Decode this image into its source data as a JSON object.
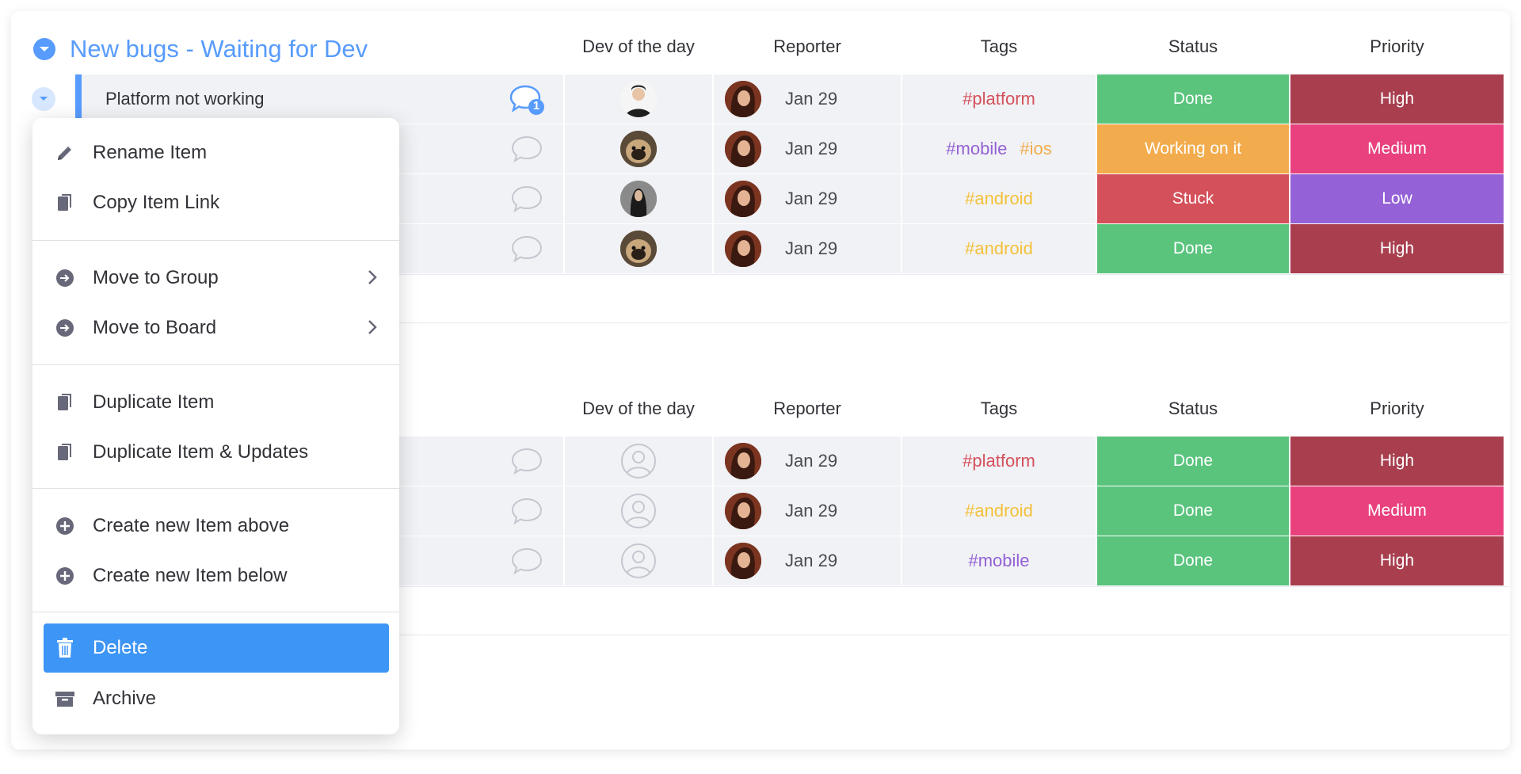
{
  "groups": [
    {
      "title": "New bugs - Waiting for Dev",
      "columns": {
        "dev": "Dev of the day",
        "reporter": "Reporter",
        "tags": "Tags",
        "status": "Status",
        "priority": "Priority"
      },
      "rows": [
        {
          "name": "Platform not working",
          "updates": "1",
          "date": "Jan 29",
          "tags": [
            "#platform"
          ],
          "status": "Done",
          "priority": "High"
        },
        {
          "name": "",
          "updates": "",
          "date": "Jan 29",
          "tags": [
            "#mobile",
            "#ios"
          ],
          "status": "Working on it",
          "priority": "Medium"
        },
        {
          "name": "",
          "updates": "",
          "date": "Jan 29",
          "tags": [
            "#android"
          ],
          "status": "Stuck",
          "priority": "Low"
        },
        {
          "name": "",
          "updates": "",
          "date": "Jan 29",
          "tags": [
            "#android"
          ],
          "status": "Done",
          "priority": "High"
        }
      ]
    },
    {
      "title": "",
      "columns": {
        "dev": "Dev of the day",
        "reporter": "Reporter",
        "tags": "Tags",
        "status": "Status",
        "priority": "Priority"
      },
      "rows": [
        {
          "date": "Jan 29",
          "tags": [
            "#platform"
          ],
          "status": "Done",
          "priority": "High"
        },
        {
          "date": "Jan 29",
          "tags": [
            "#android"
          ],
          "status": "Done",
          "priority": "Medium"
        },
        {
          "date": "Jan 29",
          "tags": [
            "#mobile"
          ],
          "status": "Done",
          "priority": "High"
        }
      ]
    }
  ],
  "menu": {
    "rename": "Rename Item",
    "copy_link": "Copy Item Link",
    "move_group": "Move to Group",
    "move_board": "Move to Board",
    "duplicate": "Duplicate Item",
    "duplicate_updates": "Duplicate Item & Updates",
    "create_above": "Create new Item above",
    "create_below": "Create new Item below",
    "delete": "Delete",
    "archive": "Archive"
  },
  "colors": {
    "accent": "#579bfc",
    "status_done": "#5ac47d",
    "status_working": "#f2ac4d",
    "status_stuck": "#d4505b",
    "priority_high": "#a83e4e",
    "priority_medium": "#e8417e",
    "priority_low": "#9461d6",
    "tag_platform": "#d4505b",
    "tag_mobile": "#9461d6",
    "tag_ios": "#f2ac4d",
    "tag_android": "#f4c13a",
    "menu_active": "#3d95f5"
  },
  "icons": {
    "collapse": "chevron-down-icon",
    "update": "speech-bubble-icon",
    "rename": "pencil-icon",
    "copy": "copy-icon",
    "move": "arrow-circle-icon",
    "submenu": "chevron-right-icon",
    "create": "plus-circle-icon",
    "delete": "trash-icon",
    "archive": "archive-box-icon",
    "empty_person": "person-outline-icon"
  }
}
